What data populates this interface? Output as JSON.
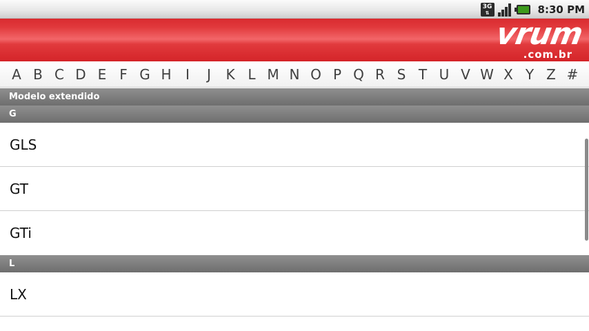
{
  "status_bar": {
    "network_label": "3G",
    "network_arrows": "⇅",
    "time": "8:30 PM",
    "colors": {
      "battery": "#3d9a1c"
    }
  },
  "header": {
    "logo_word": "vrum",
    "logo_domain": ".com.br",
    "colors": {
      "brand_red": "#e1393c"
    }
  },
  "alphabet": [
    "A",
    "B",
    "C",
    "D",
    "E",
    "F",
    "G",
    "H",
    "I",
    "J",
    "K",
    "L",
    "M",
    "N",
    "O",
    "P",
    "Q",
    "R",
    "S",
    "T",
    "U",
    "V",
    "W",
    "X",
    "Y",
    "Z",
    "#"
  ],
  "section_title": "Modelo extendido",
  "groups": [
    {
      "letter": "G",
      "items": [
        "GLS",
        "GT",
        "GTi"
      ]
    },
    {
      "letter": "L",
      "items": [
        "LX"
      ]
    }
  ]
}
